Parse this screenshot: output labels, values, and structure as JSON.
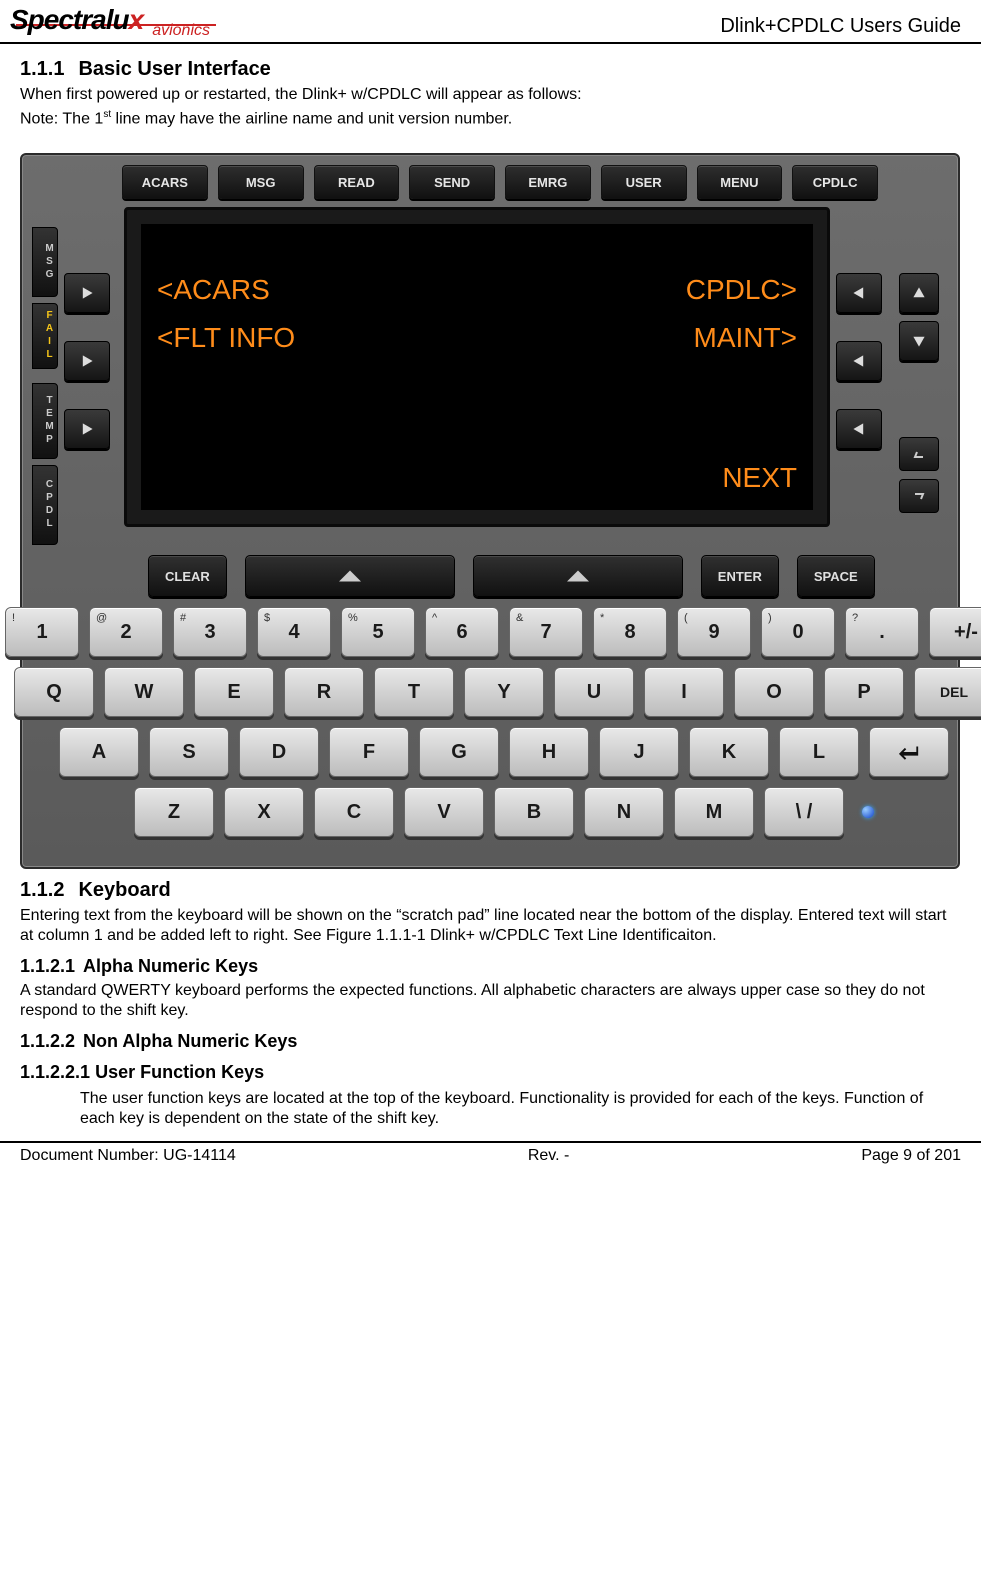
{
  "header": {
    "logo_main_a": "Spectralu",
    "logo_main_b": "x",
    "logo_sub": "avionics",
    "doc_title": "Dlink+CPDLC Users Guide"
  },
  "s111": {
    "num": "1.1.1",
    "title": "Basic User Interface",
    "p1": "When first powered up or restarted, the Dlink+ w/CPDLC will appear as follows:",
    "p2a": "Note: The 1",
    "p2sup": "st",
    "p2b": " line may have the airline name and unit version number."
  },
  "device": {
    "topkeys": [
      "ACARS",
      "MSG",
      "READ",
      "SEND",
      "EMRG",
      "USER",
      "MENU",
      "CPDLC"
    ],
    "side_left": {
      "msg": "MSG",
      "fail": "FAIL",
      "temp": "TEMP",
      "cpdl": "CPDL"
    },
    "screen": {
      "r1l": "<ACARS",
      "r1r": "CPDLC>",
      "r2l": "<FLT INFO",
      "r2r": "MAINT>",
      "r3": "NEXT"
    },
    "ctrl": {
      "clear": "CLEAR",
      "enter": "ENTER",
      "space": "SPACE"
    },
    "row_num": [
      {
        "s": "!",
        "m": "1"
      },
      {
        "s": "@",
        "m": "2"
      },
      {
        "s": "#",
        "m": "3"
      },
      {
        "s": "$",
        "m": "4"
      },
      {
        "s": "%",
        "m": "5"
      },
      {
        "s": "^",
        "m": "6"
      },
      {
        "s": "&",
        "m": "7"
      },
      {
        "s": "*",
        "m": "8"
      },
      {
        "s": "(",
        "m": "9"
      },
      {
        "s": ")",
        "m": "0"
      },
      {
        "s": "?",
        "m": "."
      },
      {
        "s": "",
        "m": "+/-"
      }
    ],
    "row_q": [
      "Q",
      "W",
      "E",
      "R",
      "T",
      "Y",
      "U",
      "I",
      "O",
      "P",
      "DEL"
    ],
    "row_a": [
      "A",
      "S",
      "D",
      "F",
      "G",
      "H",
      "J",
      "K",
      "L"
    ],
    "row_z": [
      "Z",
      "X",
      "C",
      "V",
      "B",
      "N",
      "M",
      "\\ /"
    ]
  },
  "s112": {
    "num": "1.1.2",
    "title": "Keyboard",
    "p1": "Entering text from the keyboard will be shown on the “scratch pad” line located near the bottom of the display.  Entered text will start at column 1 and be added left to right.  See Figure 1.1.1-1 Dlink+ w/CPDLC Text Line Identificaiton."
  },
  "s1121": {
    "num": "1.1.2.1",
    "title": "Alpha Numeric Keys",
    "p1": "A standard QWERTY keyboard performs the expected functions. All alphabetic characters are always upper case so they do not respond to the shift key."
  },
  "s1122": {
    "num": "1.1.2.2",
    "title": "Non Alpha Numeric Keys"
  },
  "s11221": {
    "num": "1.1.2.2.1",
    "title": "User Function Keys",
    "p1": "The user function keys are located at the top of the keyboard. Functionality is provided for each of the keys.  Function of each key is dependent on the state of the shift key."
  },
  "footer": {
    "left": "Document Number:  UG-14114",
    "center": "Rev. -",
    "right": "Page 9 of 201"
  }
}
